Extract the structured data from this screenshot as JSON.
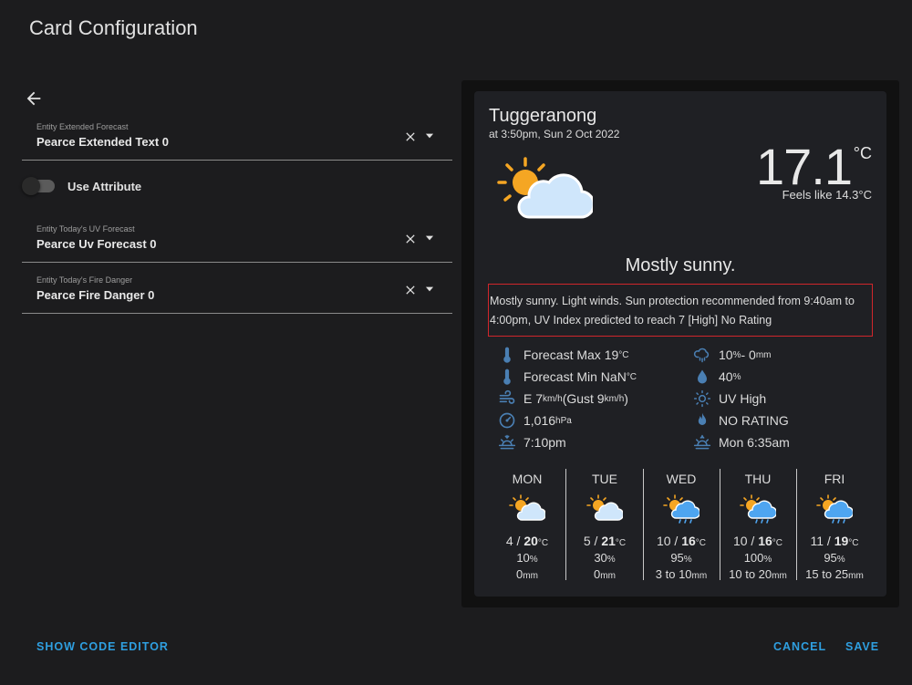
{
  "dialog": {
    "title": "Card Configuration"
  },
  "editor": {
    "fields": [
      {
        "label": "Entity Extended Forecast",
        "value": "Pearce Extended Text 0"
      },
      {
        "label": "Entity Today's UV Forecast",
        "value": "Pearce Uv Forecast 0"
      },
      {
        "label": "Entity Today's Fire Danger",
        "value": "Pearce Fire Danger 0"
      }
    ],
    "toggle": {
      "label": "Use Attribute",
      "on": false
    }
  },
  "card": {
    "location": "Tuggeranong",
    "time": "at 3:50pm, Sun 2 Oct 2022",
    "temperature": "17.1",
    "temp_unit": "°C",
    "feels_like": "Feels like 14.3°C",
    "summary": "Mostly sunny.",
    "description": "Mostly sunny. Light winds. Sun protection recommended from 9:40am to 4:00pm, UV Index predicted to reach 7 [High] No Rating",
    "attributes": {
      "forecast_max": {
        "text": "Forecast Max 19",
        "unit": "°C"
      },
      "forecast_min": {
        "text": "Forecast Min NaN",
        "unit": "°C"
      },
      "wind_pre": "E 7",
      "wind_unit": "km/h",
      "wind_gust": " (Gust 9",
      "wind_gust_unit": "km/h",
      "wind_close": ")",
      "pressure": "1,016",
      "pressure_unit": "hPa",
      "sunset": "7:10pm",
      "rain_pct": "10",
      "rain_mid": " - 0",
      "rain_mm": "mm",
      "pct": "%",
      "humidity": "40",
      "uv": "UV High",
      "fire": "NO RATING",
      "sunrise": "Mon 6:35am"
    },
    "forecast": [
      {
        "day": "MON",
        "low": "4",
        "high": "20",
        "unit": "°C",
        "pop": "10",
        "rain": "0",
        "rain_unit": "mm",
        "icon": "partly-cloudy"
      },
      {
        "day": "TUE",
        "low": "5",
        "high": "21",
        "unit": "°C",
        "pop": "30",
        "rain": "0",
        "rain_unit": "mm",
        "icon": "partly-cloudy"
      },
      {
        "day": "WED",
        "low": "10",
        "high": "16",
        "unit": "°C",
        "pop": "95",
        "rain": "3 to 10",
        "rain_unit": "mm",
        "icon": "partly-cloudy-rain"
      },
      {
        "day": "THU",
        "low": "10",
        "high": "16",
        "unit": "°C",
        "pop": "100",
        "rain": "10 to 20",
        "rain_unit": "mm",
        "icon": "partly-cloudy-rain"
      },
      {
        "day": "FRI",
        "low": "11",
        "high": "19",
        "unit": "°C",
        "pop": "95",
        "rain": "15 to 25",
        "rain_unit": "mm",
        "icon": "partly-cloudy-rain"
      }
    ],
    "pop_unit": "%"
  },
  "footer": {
    "show_code_editor": "SHOW CODE EDITOR",
    "cancel": "CANCEL",
    "save": "SAVE"
  },
  "colors": {
    "accent": "#2f9fe0",
    "background": "#1c1c1e",
    "card": "#1f2024",
    "highlight_border": "#d0262b",
    "sun": "#f5a623",
    "cloud": "#cfe6fb",
    "icon": "#4a7fb3"
  }
}
